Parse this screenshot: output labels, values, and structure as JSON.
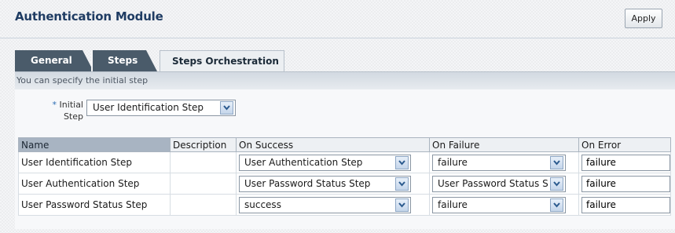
{
  "header": {
    "title": "Authentication Module",
    "apply_label": "Apply"
  },
  "tabs": [
    {
      "label": "General",
      "active": false
    },
    {
      "label": "Steps",
      "active": false
    },
    {
      "label": "Steps Orchestration",
      "active": true
    }
  ],
  "panel": {
    "hint": "You can specify the initial step",
    "initial_step": {
      "required_mark": "*",
      "label_line1": "Initial",
      "label_line2": "Step",
      "value": "User Identification Step"
    }
  },
  "table": {
    "columns": [
      "Name",
      "Description",
      "On Success",
      "On Failure",
      "On Error"
    ],
    "rows": [
      {
        "name": "User Identification Step",
        "description": "",
        "on_success": "User Authentication Step",
        "on_failure": "failure",
        "on_error": "failure"
      },
      {
        "name": "User Authentication Step",
        "description": "",
        "on_success": "User Password Status Step",
        "on_failure": "User Password Status S",
        "on_error": "failure"
      },
      {
        "name": "User Password Status Step",
        "description": "",
        "on_success": "success",
        "on_failure": "failure",
        "on_error": "failure"
      }
    ]
  },
  "icons": {
    "dropdown": "chevron-down-icon"
  },
  "colors": {
    "title": "#1f3c63",
    "tab_inactive": "#4a5b6a",
    "tab_active": "#eceff2",
    "header_sorted": "#a8b4c2",
    "required_mark": "#2a6cb3"
  }
}
